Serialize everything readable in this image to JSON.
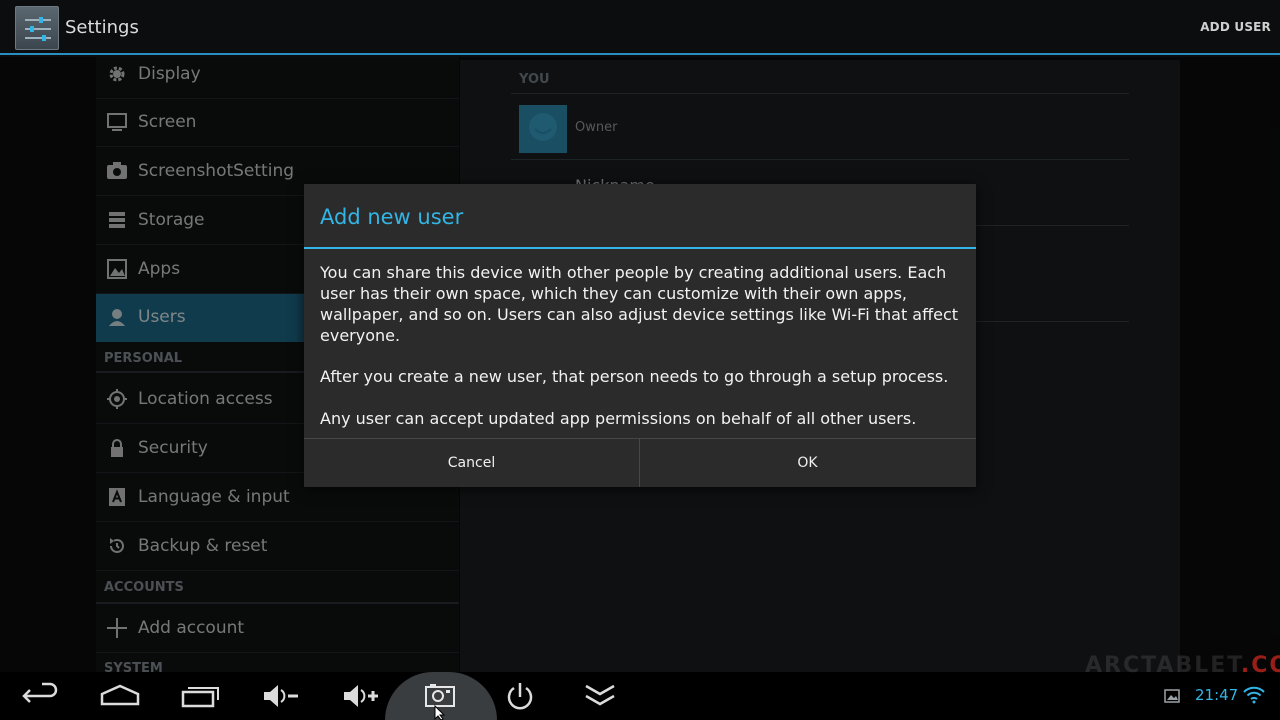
{
  "actionbar": {
    "title": "Settings",
    "add_user": "ADD USER"
  },
  "sidebar": {
    "items": [
      {
        "label": "Display",
        "icon": "display-icon"
      },
      {
        "label": "Screen",
        "icon": "screen-icon"
      },
      {
        "label": "ScreenshotSetting",
        "icon": "camera-icon"
      },
      {
        "label": "Storage",
        "icon": "storage-icon"
      },
      {
        "label": "Apps",
        "icon": "apps-icon"
      },
      {
        "label": "Users",
        "icon": "user-icon",
        "selected": true
      }
    ],
    "personal_header": "PERSONAL",
    "personal_items": [
      {
        "label": "Location access",
        "icon": "location-icon"
      },
      {
        "label": "Security",
        "icon": "lock-icon"
      },
      {
        "label": "Language & input",
        "icon": "language-icon"
      },
      {
        "label": "Backup & reset",
        "icon": "backup-icon"
      }
    ],
    "accounts_header": "ACCOUNTS",
    "add_account": "Add account",
    "system_header": "SYSTEM"
  },
  "detail": {
    "you_header": "YOU",
    "owner_label": "Owner",
    "nickname_label": "Nickname"
  },
  "dialog": {
    "title": "Add new user",
    "paragraphs": [
      "You can share this device with other people by creating additional users. Each user has their own space, which they can customize with their own apps, wallpaper, and so on. Users can also adjust device settings like Wi-Fi that affect everyone.",
      "After you create a new user, that person needs to go through a setup process.",
      "Any user can accept updated app permissions on behalf of all other users."
    ],
    "cancel": "Cancel",
    "ok": "OK"
  },
  "navbar": {
    "buttons": [
      "back-icon",
      "home-icon",
      "recents-icon",
      "volume-down-icon",
      "volume-up-icon",
      "screenshot-icon",
      "power-icon",
      "collapse-icon"
    ],
    "clock": "21:47"
  },
  "watermark": {
    "main": "ARCTABLET",
    "suffix": ".COM"
  },
  "colors": {
    "accent": "#33b5e5",
    "selected": "#1e6c8c"
  }
}
